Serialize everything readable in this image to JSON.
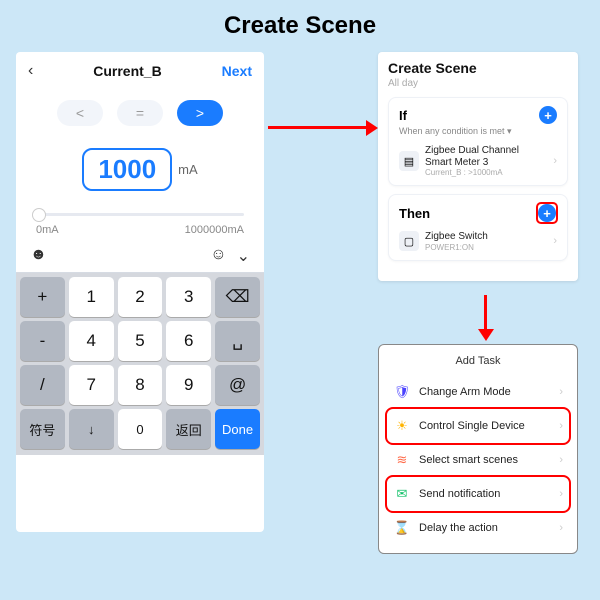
{
  "main_title": "Create Scene",
  "left": {
    "back_glyph": "‹",
    "title": "Current_B",
    "next": "Next",
    "ops": {
      "lt": "<",
      "eq": "=",
      "gt": ">"
    },
    "value": "1000",
    "unit": "mA",
    "range_min": "0mA",
    "range_max": "1000000mA",
    "iconbar": {
      "sticker": "☻",
      "smile": "☺",
      "caret": "⌄"
    },
    "keys": {
      "r1": [
        "+",
        "1",
        "2",
        "3"
      ],
      "back": "⌫",
      "r2": [
        "-",
        "4",
        "5",
        "6"
      ],
      "space": "␣",
      "r3": [
        "/",
        "7",
        "8",
        "9"
      ],
      "at": "@",
      "r4": [
        "符号",
        "↓",
        "0",
        "返回"
      ],
      "done": "Done"
    }
  },
  "rt": {
    "title": "Create Scene",
    "subtitle": "All day",
    "if": {
      "label": "If",
      "sub": "When any condition is met ▾",
      "device": "Zigbee Dual Channel Smart Meter 3",
      "cond": "Current_B : >1000mA"
    },
    "then": {
      "label": "Then",
      "device": "Zigbee Switch",
      "cond": "POWER1:ON"
    }
  },
  "rb": {
    "title": "Add Task",
    "tasks": [
      {
        "icon": "🛡",
        "label": "Change Arm Mode",
        "cls": "shield",
        "hl": false
      },
      {
        "icon": "☀",
        "label": "Control Single Device",
        "cls": "sun",
        "hl": true
      },
      {
        "icon": "≋",
        "label": "Select smart scenes",
        "cls": "scenes",
        "hl": false
      },
      {
        "icon": "✉",
        "label": "Send notification",
        "cls": "msg",
        "hl": true
      },
      {
        "icon": "⌛",
        "label": "Delay the action",
        "cls": "hour",
        "hl": false
      }
    ]
  },
  "chev": "›",
  "plus": "+"
}
